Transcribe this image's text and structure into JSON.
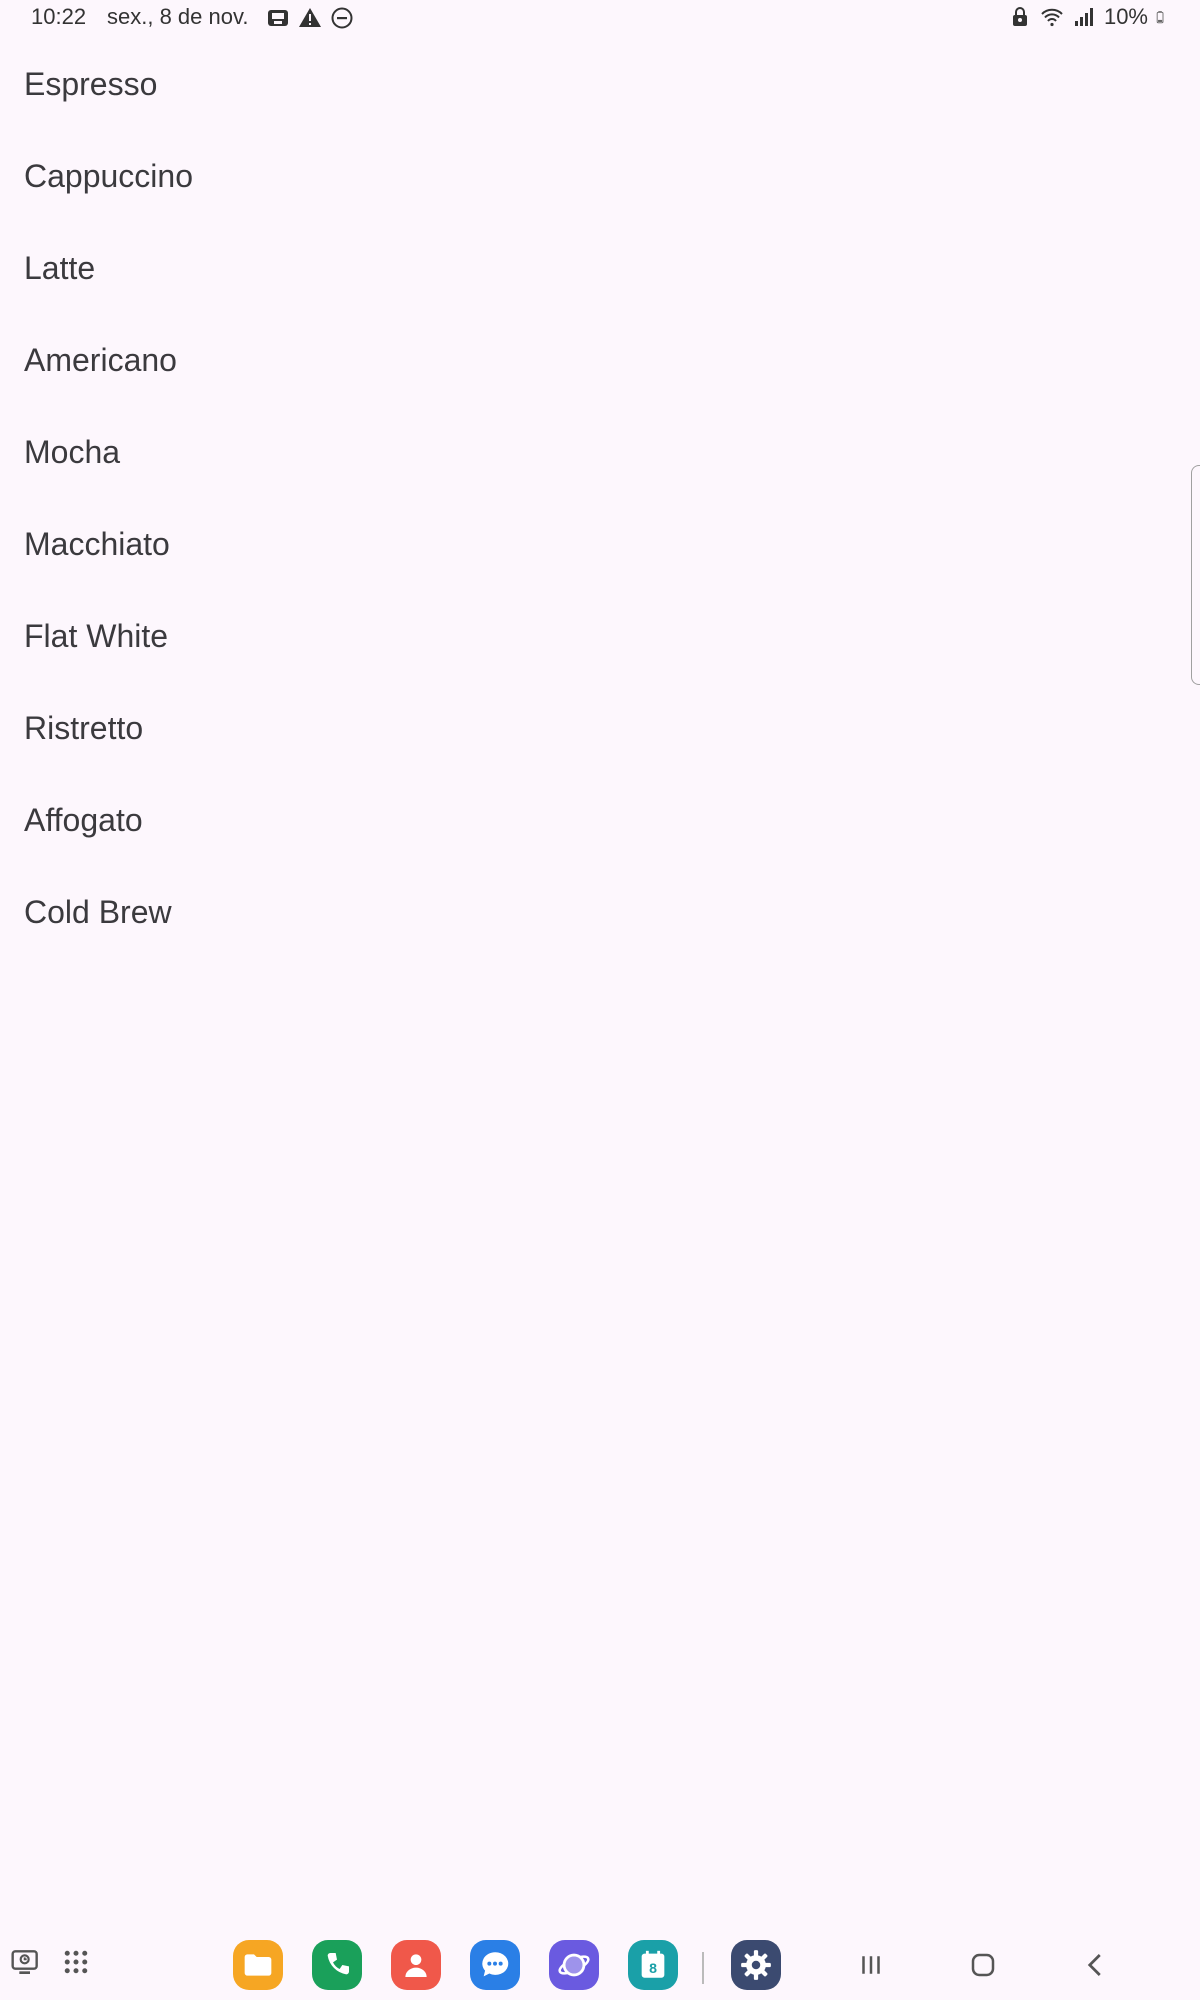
{
  "status_bar": {
    "time": "10:22",
    "date": "sex., 8 de nov.",
    "battery": "10%",
    "left_icons": [
      "screenshot-icon",
      "warning-icon",
      "do-not-disturb-icon"
    ],
    "right_icons": [
      "lock-icon",
      "wifi-icon",
      "signal-icon",
      "battery-icon"
    ]
  },
  "coffee_list": {
    "items": [
      "Espresso",
      "Cappuccino",
      "Latte",
      "Americano",
      "Mocha",
      "Macchiato",
      "Flat White",
      "Ristretto",
      "Affogato",
      "Cold Brew"
    ]
  },
  "taskbar": {
    "left_buttons": [
      "recent-screenshots-icon",
      "app-drawer-icon"
    ],
    "apps": [
      {
        "name": "my-files-icon",
        "color": "#f6a623"
      },
      {
        "name": "phone-icon",
        "color": "#1aa05a"
      },
      {
        "name": "contacts-icon",
        "color": "#f0584a"
      },
      {
        "name": "messages-icon",
        "color": "#2a7fe6"
      },
      {
        "name": "internet-icon",
        "color": "#6a5ae0"
      },
      {
        "name": "calendar-icon",
        "color": "#1aa0a8",
        "label": "8"
      },
      {
        "name": "settings-icon",
        "color": "#3b4a70"
      }
    ],
    "nav": [
      "recents-button",
      "home-button",
      "back-button"
    ]
  },
  "colors": {
    "background": "#fdf7fd",
    "text": "#3b3a3e"
  }
}
